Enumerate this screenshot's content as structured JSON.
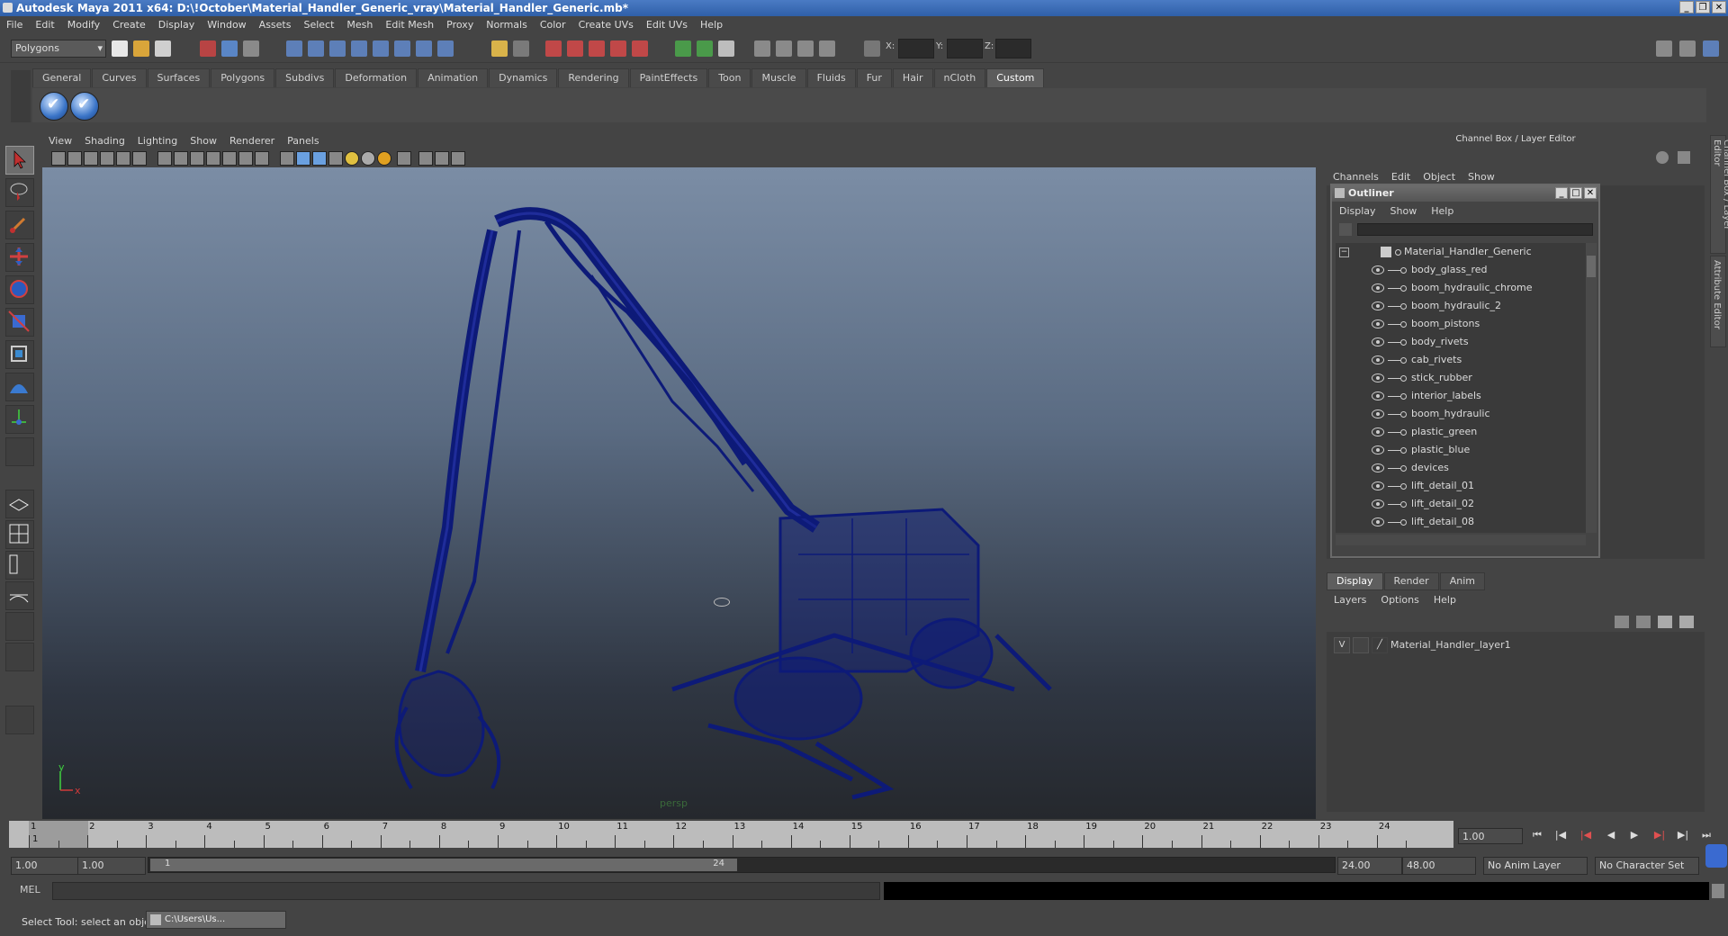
{
  "window": {
    "title": "Autodesk Maya 2011 x64: D:\\!October\\Material_Handler_Generic_vray\\Material_Handler_Generic.mb*"
  },
  "menubar": [
    "File",
    "Edit",
    "Modify",
    "Create",
    "Display",
    "Window",
    "Assets",
    "Select",
    "Mesh",
    "Edit Mesh",
    "Proxy",
    "Normals",
    "Color",
    "Create UVs",
    "Edit UVs",
    "Help"
  ],
  "statusline": {
    "menuset": "Polygons",
    "x_label": "X:",
    "y_label": "Y:",
    "z_label": "Z:"
  },
  "shelf": {
    "tabs": [
      "General",
      "Curves",
      "Surfaces",
      "Polygons",
      "Subdivs",
      "Deformation",
      "Animation",
      "Dynamics",
      "Rendering",
      "PaintEffects",
      "Toon",
      "Muscle",
      "Fluids",
      "Fur",
      "Hair",
      "nCloth",
      "Custom"
    ],
    "active_tab": "Custom"
  },
  "viewport": {
    "menu": [
      "View",
      "Shading",
      "Lighting",
      "Show",
      "Renderer",
      "Panels"
    ],
    "camera_label": "persp",
    "axis_x": "x",
    "axis_y": "y",
    "wire_color": "#0d1a78"
  },
  "channel_box": {
    "header": "Channel Box / Layer Editor",
    "menu": [
      "Channels",
      "Edit",
      "Object",
      "Show"
    ],
    "side_tabs": [
      "Channel Box / Layer Editor",
      "Attribute Editor"
    ]
  },
  "outliner": {
    "title": "Outliner",
    "menu": [
      "Display",
      "Show",
      "Help"
    ],
    "root": "Material_Handler_Generic",
    "items": [
      "body_glass_red",
      "boom_hydraulic_chrome",
      "boom_hydraulic_2",
      "boom_pistons",
      "body_rivets",
      "cab_rivets",
      "stick_rubber",
      "interior_labels",
      "boom_hydraulic",
      "plastic_green",
      "plastic_blue",
      "devices",
      "lift_detail_01",
      "lift_detail_02",
      "lift_detail_08"
    ]
  },
  "layer_editor": {
    "tabs": [
      "Display",
      "Render",
      "Anim"
    ],
    "active_tab": "Display",
    "menu": [
      "Layers",
      "Options",
      "Help"
    ],
    "layer": {
      "visible": "V",
      "name": "Material_Handler_layer1"
    }
  },
  "time_slider": {
    "ticks": [
      "1",
      "2",
      "3",
      "4",
      "5",
      "6",
      "7",
      "8",
      "9",
      "10",
      "11",
      "12",
      "13",
      "14",
      "15",
      "16",
      "17",
      "18",
      "19",
      "20",
      "21",
      "22",
      "23",
      "24"
    ],
    "current_frame": "1.00",
    "current_marker": "1"
  },
  "range_slider": {
    "start": "1.00",
    "playback_start": "1.00",
    "range_start_label": "1",
    "range_end_label": "24",
    "playback_end": "24.00",
    "end": "48.00",
    "anim_layer": "No Anim Layer",
    "character_set": "No Character Set"
  },
  "command_line": {
    "label": "MEL"
  },
  "help_line": {
    "text": "Select Tool: select an object",
    "taskbar_item": "C:\\Users\\Us..."
  }
}
